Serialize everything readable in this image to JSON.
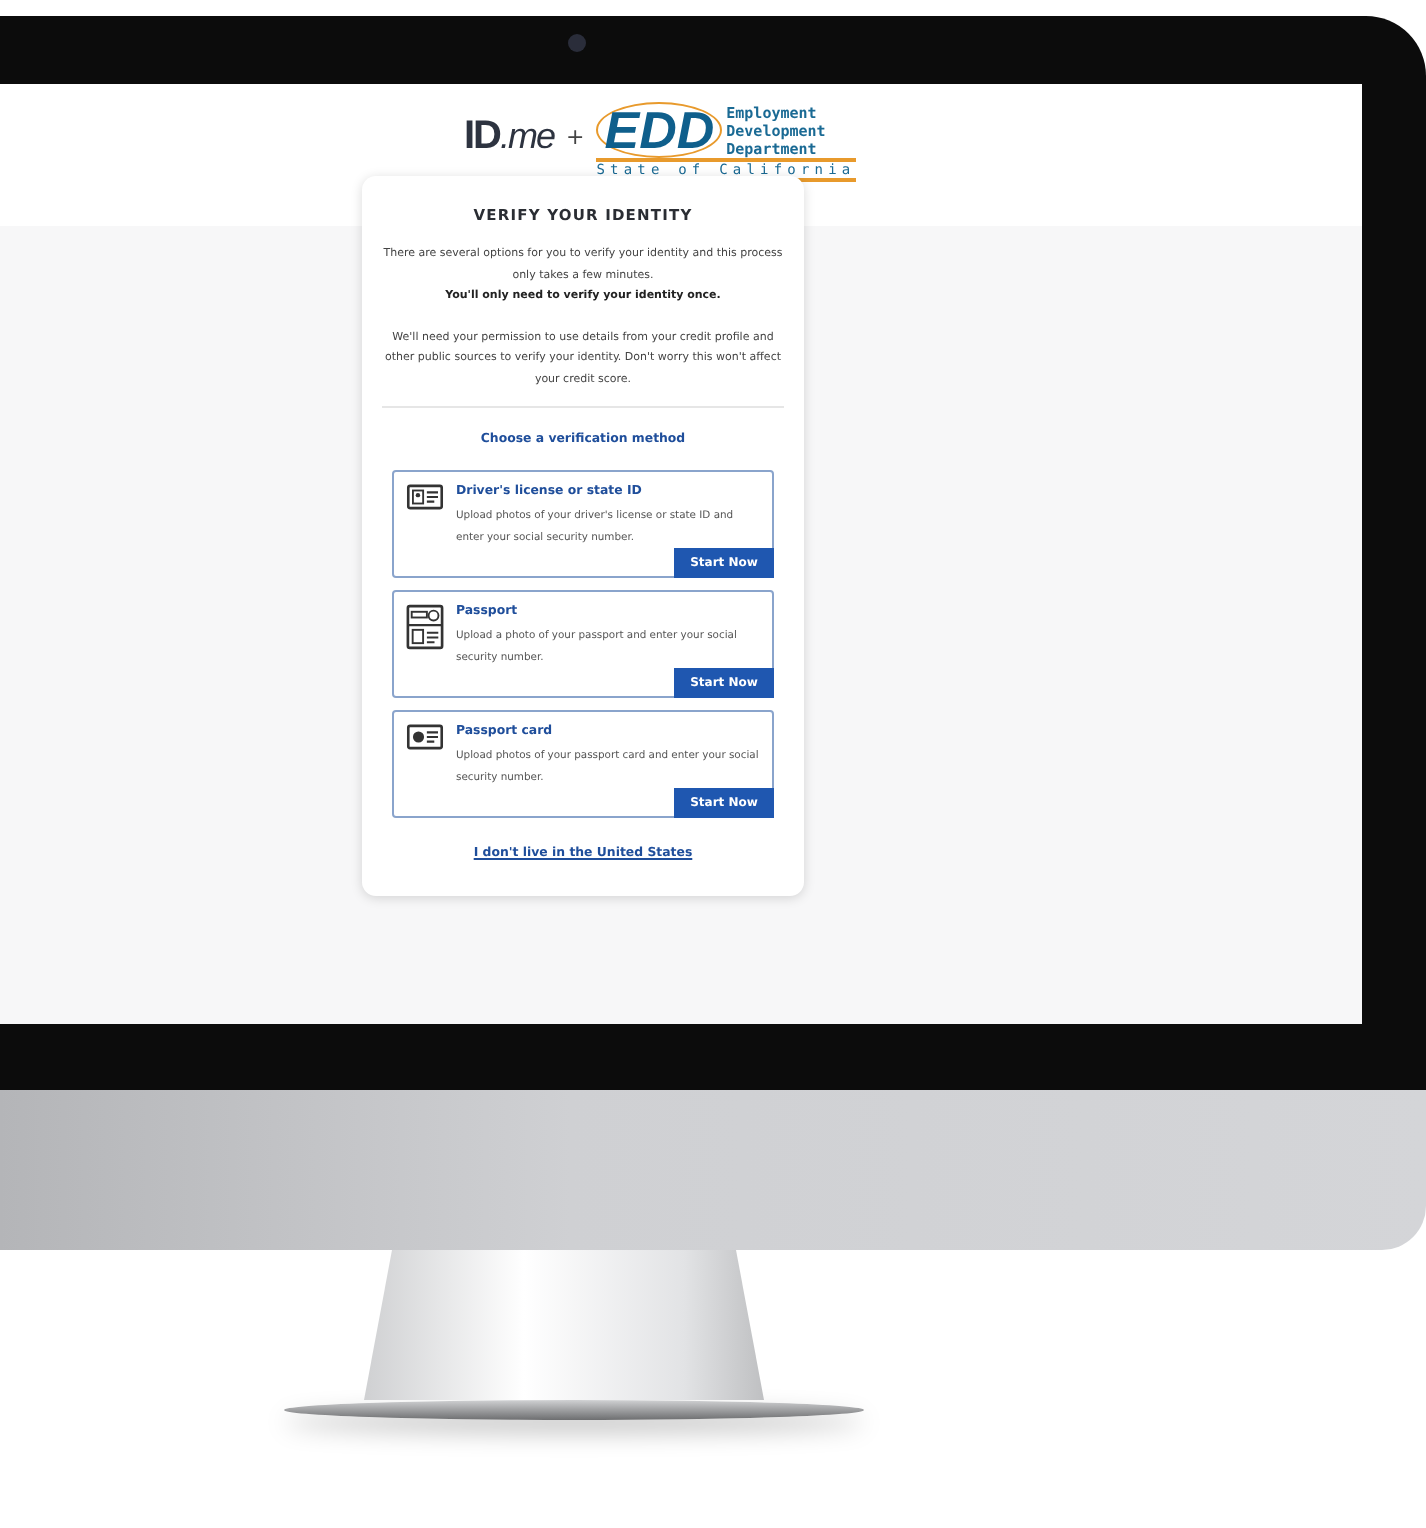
{
  "header": {
    "idme": {
      "brand": "ID",
      "suffix": ".me"
    },
    "plus": "+",
    "edd": {
      "mark": "EDD",
      "lines": [
        "Employment",
        "Development",
        "Department"
      ],
      "state": "State of California"
    }
  },
  "card": {
    "title": "VERIFY YOUR IDENTITY",
    "intro": "There are several options for you to verify your identity and this process only takes a few minutes.",
    "intro_bold": "You'll only need to verify your identity once.",
    "permission": "We'll need your permission to use details from your credit profile and other public sources to verify your identity. Don't worry this won't affect your credit score.",
    "method_heading": "Choose a verification method",
    "methods": [
      {
        "kind": "license",
        "title": "Driver's license or state ID",
        "description": "Upload photos of your driver's license or state ID and enter your social security number.",
        "button": "Start Now"
      },
      {
        "kind": "passport",
        "title": "Passport",
        "description": "Upload a photo of your passport and enter your social security number.",
        "button": "Start Now"
      },
      {
        "kind": "passport-card",
        "title": "Passport card",
        "description": "Upload photos of your passport card and enter your social security number.",
        "button": "Start Now"
      }
    ],
    "link": "I don't live in the United States"
  }
}
